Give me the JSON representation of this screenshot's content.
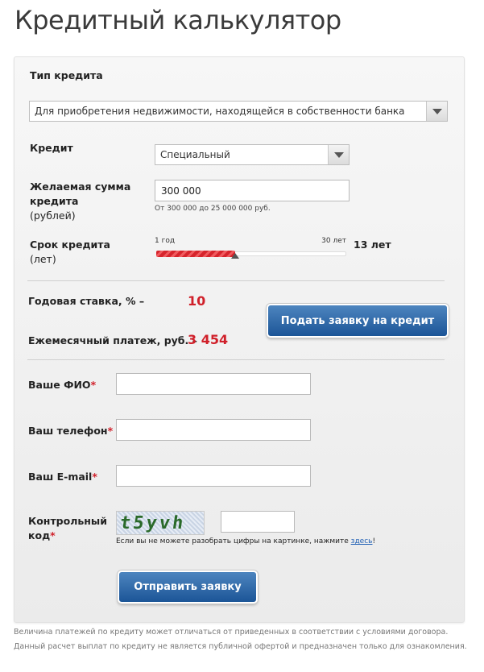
{
  "page": {
    "title": "Кредитный калькулятор"
  },
  "form": {
    "credit_type": {
      "label": "Тип кредита",
      "selected": "Для приобретения недвижимости, находящейся в собственности банка"
    },
    "credit": {
      "label": "Кредит",
      "selected": "Специальный"
    },
    "amount": {
      "label": "Желаемая сумма кредита",
      "unit": "(рублей)",
      "value": "300 000",
      "hint": "От 300 000 до 25 000 000 руб."
    },
    "term": {
      "label": "Срок кредита",
      "unit": "(лет)",
      "min_label": "1 год",
      "max_label": "30 лет",
      "value_label": "13 лет",
      "min": 1,
      "max": 30,
      "value": 13
    }
  },
  "results": {
    "rate_label": "Годовая ставка, % –",
    "rate_value": "10",
    "payment_label": "Ежемесячный платеж, руб. –",
    "payment_value": "3 454",
    "apply_button": "Подать заявку на кредит"
  },
  "application": {
    "name_label": "Ваше ФИО",
    "phone_label": "Ваш телефон",
    "email_label": "Ваш E-mail",
    "captcha_label_line1": "Контрольный",
    "captcha_label_line2": "код",
    "required_mark": "*",
    "captcha_text": "t5yvh",
    "captcha_note": "Если вы не можете разобрать цифры на картинке, нажмите ",
    "captcha_link": "здесь",
    "captcha_note_end": "!",
    "submit_button": "Отправить заявку"
  },
  "footnotes": {
    "line1": "Величина платежей по кредиту может отличаться от приведенных в соответствии с условиями договора.",
    "line2": "Данный расчет выплат по кредиту не является публичной офертой и предназначен только для ознакомления."
  },
  "colors": {
    "accent_red": "#d0202a",
    "button_blue": "#1c5597",
    "link_blue": "#1f5fb4"
  }
}
